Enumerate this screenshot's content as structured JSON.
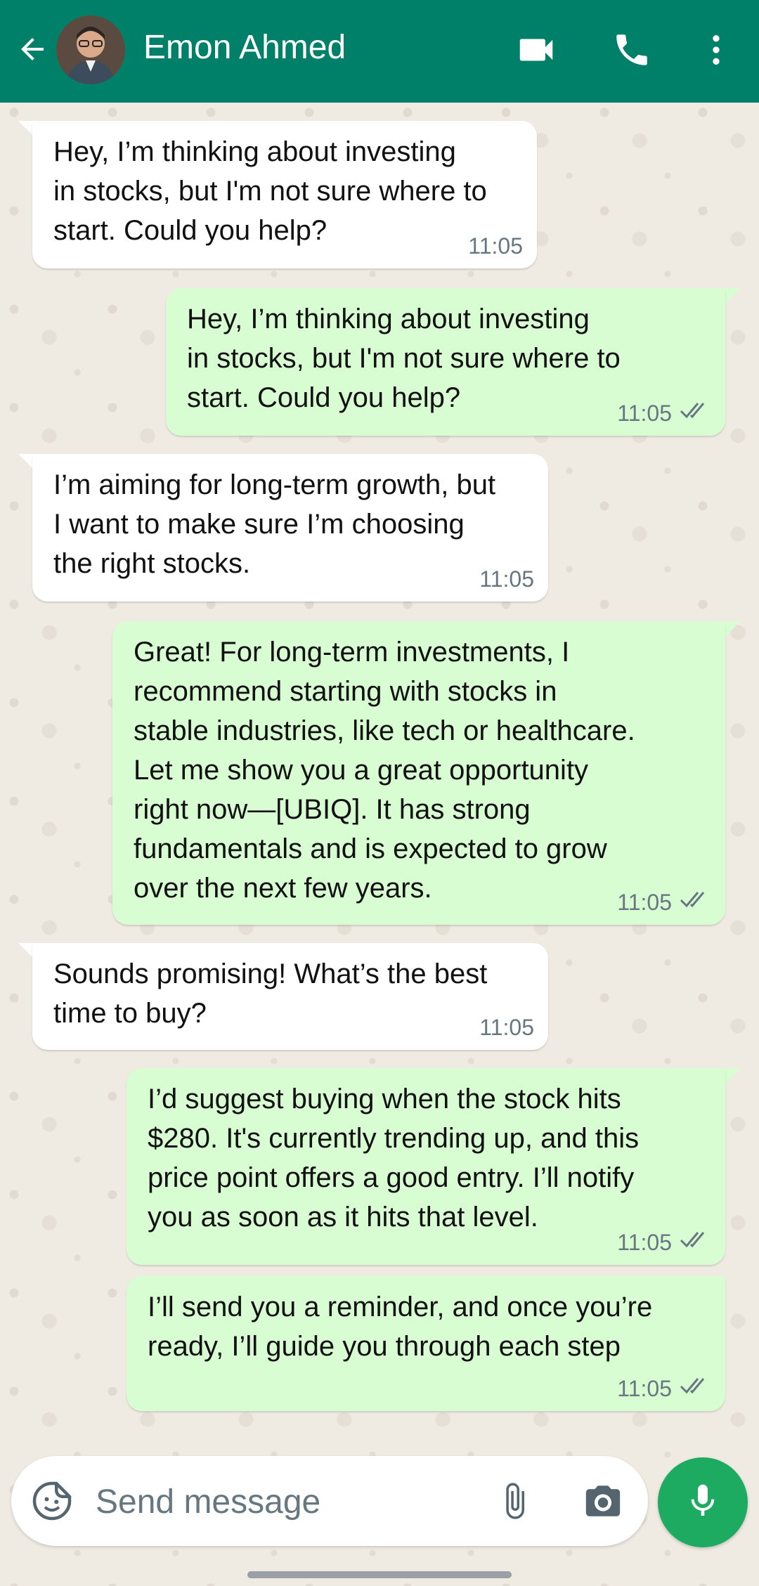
{
  "header": {
    "contact_name": "Emon Ahmed",
    "background": "#008069",
    "icons": [
      "back-arrow-icon",
      "video-call-icon",
      "phone-icon",
      "more-vertical-icon"
    ]
  },
  "messages": [
    {
      "direction": "incoming",
      "text": "Hey, I’m thinking about investing\nin stocks, but I'm not sure where to\nstart. Could you help?",
      "time": "11:05"
    },
    {
      "direction": "outgoing",
      "text": "Hey, I’m thinking about investing\nin stocks, but I'm not sure where to\nstart. Could you help?",
      "time": "11:05",
      "status": "read"
    },
    {
      "direction": "incoming",
      "text": "I’m aiming for long-term growth, but\nI want to make sure I’m choosing\nthe right stocks.",
      "time": "11:05"
    },
    {
      "direction": "outgoing",
      "text": "Great! For long-term investments, I\nrecommend starting with stocks in\nstable industries, like tech or healthcare.\nLet me show you a great opportunity\nright now—[UBIQ]. It has strong\nfundamentals and is expected to grow\nover the next few years.",
      "time": "11:05",
      "status": "read"
    },
    {
      "direction": "incoming",
      "text": "Sounds promising! What’s the best\ntime to buy?",
      "time": "11:05"
    },
    {
      "direction": "outgoing",
      "text": "I’d suggest buying when the stock hits\n$280. It's currently trending up, and this\nprice point offers a good entry. I’ll notify\nyou as soon as it hits that level.",
      "time": "11:05",
      "status": "read"
    },
    {
      "direction": "outgoing",
      "text": "I’ll send you a reminder, and once you’re\nready, I’ll guide you through each step",
      "time": "11:05",
      "status": "read"
    }
  ],
  "composer": {
    "placeholder": "Send message",
    "icons": [
      "sticker-icon",
      "attach-icon",
      "camera-icon",
      "mic-icon"
    ]
  },
  "colors": {
    "incoming_bubble": "#ffffff",
    "outgoing_bubble": "#d9fdd3",
    "chat_background": "#efeae2",
    "mic_button": "#1daa61"
  }
}
